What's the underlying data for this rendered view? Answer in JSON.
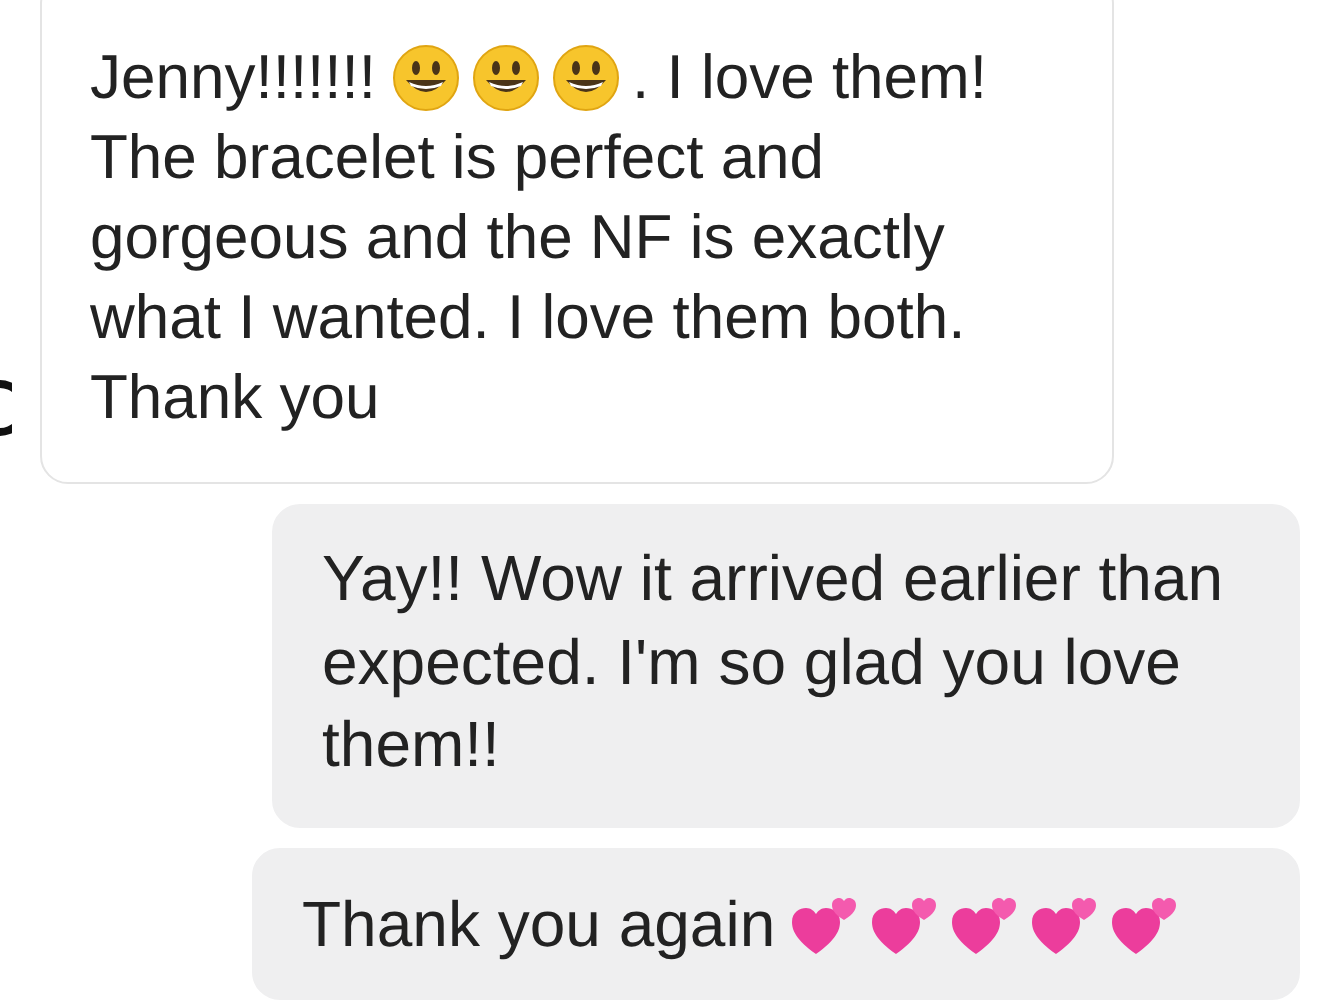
{
  "messages": [
    {
      "outgoing": false,
      "lines": [
        [
          {
            "kind": "text",
            "text": "Jenny!!!!!!!"
          },
          {
            "kind": "smiley"
          },
          {
            "kind": "smiley"
          },
          {
            "kind": "smiley"
          },
          {
            "kind": "text",
            "text": ". I love them!"
          }
        ],
        [
          {
            "kind": "text",
            "text": "The bracelet is perfect and"
          }
        ],
        [
          {
            "kind": "text",
            "text": "gorgeous and the NF is exactly"
          }
        ],
        [
          {
            "kind": "text",
            "text": "what I wanted. I love them both."
          }
        ],
        [
          {
            "kind": "text",
            "text": "Thank you"
          }
        ]
      ]
    },
    {
      "outgoing": true,
      "lines": [
        [
          {
            "kind": "text",
            "text": "Yay!! Wow it arrived earlier than"
          }
        ],
        [
          {
            "kind": "text",
            "text": "expected. I'm so glad you love"
          }
        ],
        [
          {
            "kind": "text",
            "text": "them!!"
          }
        ]
      ]
    },
    {
      "outgoing": true,
      "lines": [
        [
          {
            "kind": "text",
            "text": "Thank you again"
          },
          {
            "kind": "hearts"
          },
          {
            "kind": "hearts"
          },
          {
            "kind": "hearts"
          },
          {
            "kind": "hearts"
          },
          {
            "kind": "hearts"
          }
        ]
      ]
    }
  ]
}
